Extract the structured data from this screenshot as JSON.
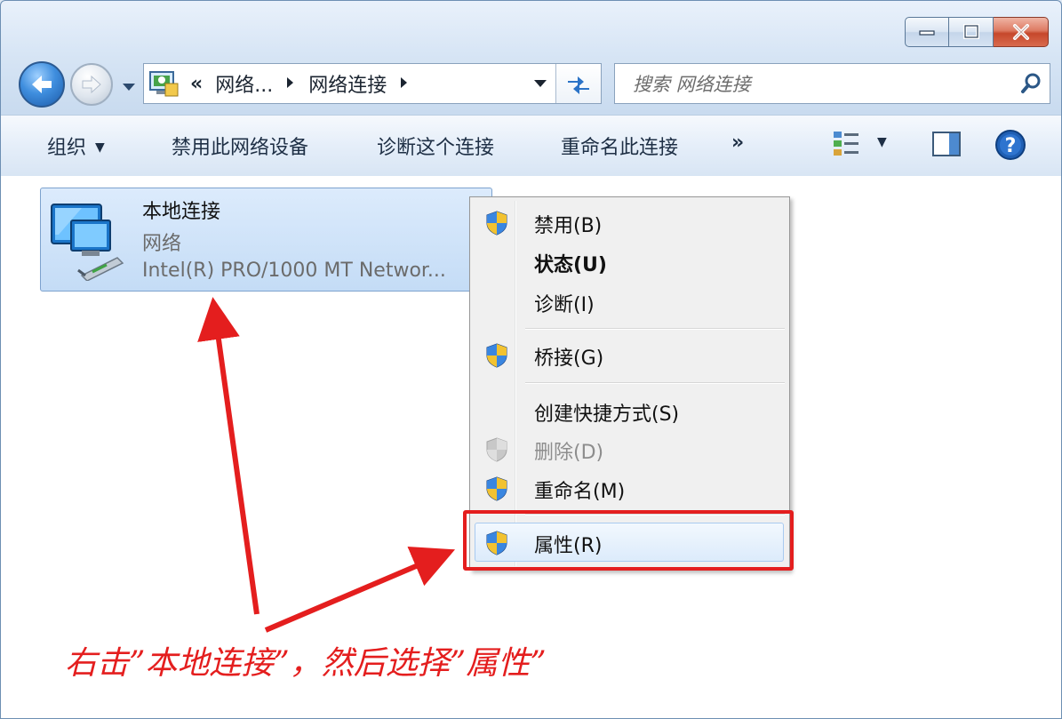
{
  "window": {
    "controls": {
      "minimize": "minimize",
      "maximize": "maximize",
      "close": "close"
    }
  },
  "navigation": {
    "breadcrumb": [
      "网络...",
      "网络连接"
    ],
    "overflow_glyph": "«",
    "search_placeholder": "搜索 网络连接"
  },
  "command_bar": {
    "organize": "组织",
    "disable_device": "禁用此网络设备",
    "diagnose": "诊断这个连接",
    "rename": "重命名此连接",
    "more": "»"
  },
  "connection": {
    "name": "本地连接",
    "type": "网络",
    "device": "Intel(R) PRO/1000 MT Networ..."
  },
  "context_menu": {
    "items": [
      {
        "label": "禁用(B)",
        "shield": true,
        "bold": false,
        "disabled": false
      },
      {
        "label": "状态(U)",
        "shield": false,
        "bold": true,
        "disabled": false
      },
      {
        "label": "诊断(I)",
        "shield": false,
        "bold": false,
        "disabled": false
      },
      {
        "label": "桥接(G)",
        "shield": true,
        "bold": false,
        "disabled": false
      },
      {
        "label": "创建快捷方式(S)",
        "shield": false,
        "bold": false,
        "disabled": false
      },
      {
        "label": "删除(D)",
        "shield": true,
        "bold": false,
        "disabled": true
      },
      {
        "label": "重命名(M)",
        "shield": true,
        "bold": false,
        "disabled": false
      },
      {
        "label": "属性(R)",
        "shield": true,
        "bold": false,
        "disabled": false
      }
    ]
  },
  "annotation": {
    "text": "右击”本地连接”，然后选择”属性”",
    "color": "#e41e1e"
  },
  "icons": {
    "back": "back-arrow-icon",
    "forward": "forward-arrow-icon",
    "refresh": "refresh-icon",
    "search": "search-icon",
    "uac": "uac-shield-icon",
    "network": "network-adapter-icon",
    "help": "help-icon"
  }
}
